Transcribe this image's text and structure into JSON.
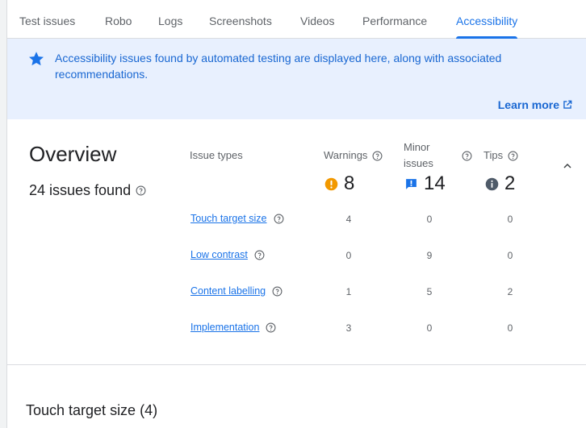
{
  "tabs": [
    {
      "label": "Test issues",
      "active": false
    },
    {
      "label": "Robo",
      "active": false
    },
    {
      "label": "Logs",
      "active": false
    },
    {
      "label": "Screenshots",
      "active": false
    },
    {
      "label": "Videos",
      "active": false
    },
    {
      "label": "Performance",
      "active": false
    },
    {
      "label": "Accessibility",
      "active": true
    }
  ],
  "banner": {
    "icon": "star-icon",
    "message": "Accessibility issues found by automated testing are displayed here, along with associated recommendations.",
    "learn_more": "Learn more",
    "learn_more_icon": "open-in-new-icon"
  },
  "overview": {
    "title": "Overview",
    "issues_found": "24 issues found",
    "columns": {
      "issue_types": "Issue types",
      "warnings": "Warnings",
      "minor_issues": "Minor issues",
      "tips": "Tips"
    },
    "totals": {
      "warnings": "8",
      "minor_issues": "14",
      "tips": "2"
    },
    "rows": [
      {
        "label": "Touch target size",
        "warnings": "4",
        "minor": "0",
        "tips": "0"
      },
      {
        "label": "Low contrast",
        "warnings": "0",
        "minor": "9",
        "tips": "0"
      },
      {
        "label": "Content labelling",
        "warnings": "1",
        "minor": "5",
        "tips": "2"
      },
      {
        "label": "Implementation",
        "warnings": "3",
        "minor": "0",
        "tips": "0"
      }
    ]
  },
  "section": {
    "title": "Touch target size (4)"
  },
  "colors": {
    "accent": "#1a73e8",
    "banner_bg": "#e8f0fe",
    "warning": "#f29900",
    "minor": "#1a73e8",
    "tip": "#5f6368"
  }
}
